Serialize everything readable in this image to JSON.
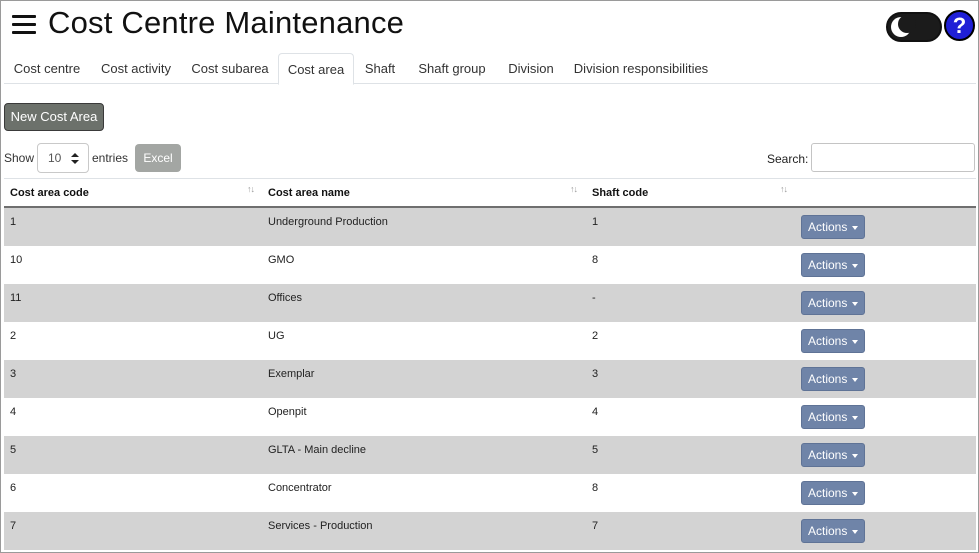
{
  "header": {
    "title": "Cost Centre Maintenance",
    "help_label": "?"
  },
  "tabs": [
    {
      "label": "Cost centre"
    },
    {
      "label": "Cost activity"
    },
    {
      "label": "Cost subarea"
    },
    {
      "label": "Cost area",
      "active": true
    },
    {
      "label": "Shaft"
    },
    {
      "label": "Shaft group"
    },
    {
      "label": "Division"
    },
    {
      "label": "Division responsibilities"
    }
  ],
  "toolbar": {
    "new_label": "New Cost Area",
    "show_label": "Show",
    "entries_value": "10",
    "entries_label": "entries",
    "excel_label": "Excel",
    "search_label": "Search:",
    "search_value": ""
  },
  "table": {
    "columns": [
      "Cost area code",
      "Cost area name",
      "Shaft code"
    ],
    "sort_glyph": "↑↓",
    "rows": [
      {
        "code": "1",
        "name": "Underground Production",
        "shaft": "1",
        "action": "Actions"
      },
      {
        "code": "10",
        "name": "GMO",
        "shaft": "8",
        "action": "Actions"
      },
      {
        "code": "11",
        "name": "Offices",
        "shaft": "-",
        "action": "Actions"
      },
      {
        "code": "2",
        "name": "UG",
        "shaft": "2",
        "action": "Actions"
      },
      {
        "code": "3",
        "name": "Exemplar",
        "shaft": "3",
        "action": "Actions"
      },
      {
        "code": "4",
        "name": "Openpit",
        "shaft": "4",
        "action": "Actions"
      },
      {
        "code": "5",
        "name": "GLTA - Main decline",
        "shaft": "5",
        "action": "Actions"
      },
      {
        "code": "6",
        "name": "Concentrator",
        "shaft": "8",
        "action": "Actions"
      },
      {
        "code": "7",
        "name": "Services - Production",
        "shaft": "7",
        "action": "Actions"
      }
    ]
  },
  "colors": {
    "actions_button": "#6f84a8",
    "help_button": "#1f1fd6",
    "striped_row": "#d3d3d3",
    "new_button": "#6c716b"
  }
}
